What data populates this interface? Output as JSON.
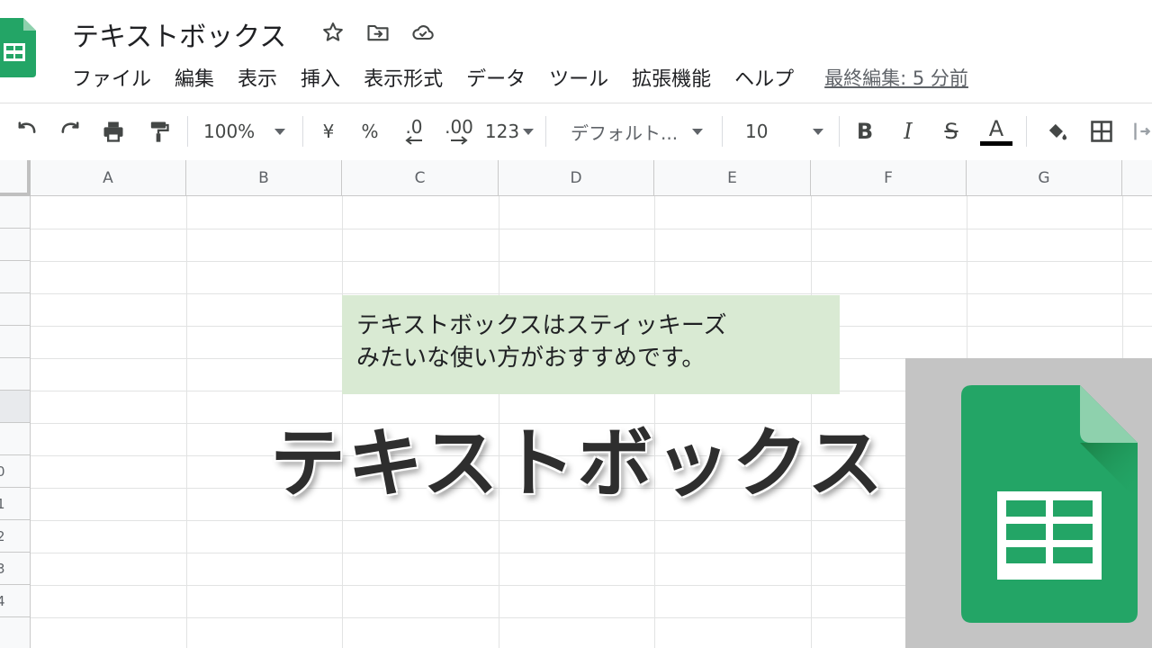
{
  "app": {
    "doc_title": "テキストボックス",
    "icons": [
      "sheets-logo-icon",
      "star-icon",
      "move-to-folder-icon",
      "cloud-saved-icon"
    ]
  },
  "menubar": {
    "items": [
      "ファイル",
      "編集",
      "表示",
      "挿入",
      "表示形式",
      "データ",
      "ツール",
      "拡張機能",
      "ヘルプ"
    ],
    "last_edit": "最終編集: 5 分前"
  },
  "toolbar": {
    "zoom": "100%",
    "currency": "¥",
    "percent": "%",
    "decrease_decimal": ".0",
    "increase_decimal": ".00",
    "number_format": "123",
    "font": "デフォルト...",
    "font_size": "10",
    "bold": "B",
    "italic": "I",
    "strikethrough": "S",
    "text_color": "A",
    "text_color_swatch": "#000000"
  },
  "grid": {
    "columns": [
      "A",
      "B",
      "C",
      "D",
      "E",
      "F",
      "G"
    ],
    "row_numbers": [
      "",
      "",
      "",
      "",
      "",
      "",
      "",
      "",
      "0",
      "1",
      "2",
      "3",
      "4"
    ]
  },
  "textbox": {
    "line1": "テキストボックスはスティッキーズ",
    "line2": "みたいな使い方がおすすめです。",
    "fill": "#d9ead3"
  },
  "overlay": {
    "title": "テキストボックス"
  },
  "colors": {
    "sheets_green": "#23a566",
    "sheets_dark_green": "#1e8e3e",
    "grid_line": "#e2e3e3",
    "header_bg": "#f8f9fa"
  }
}
